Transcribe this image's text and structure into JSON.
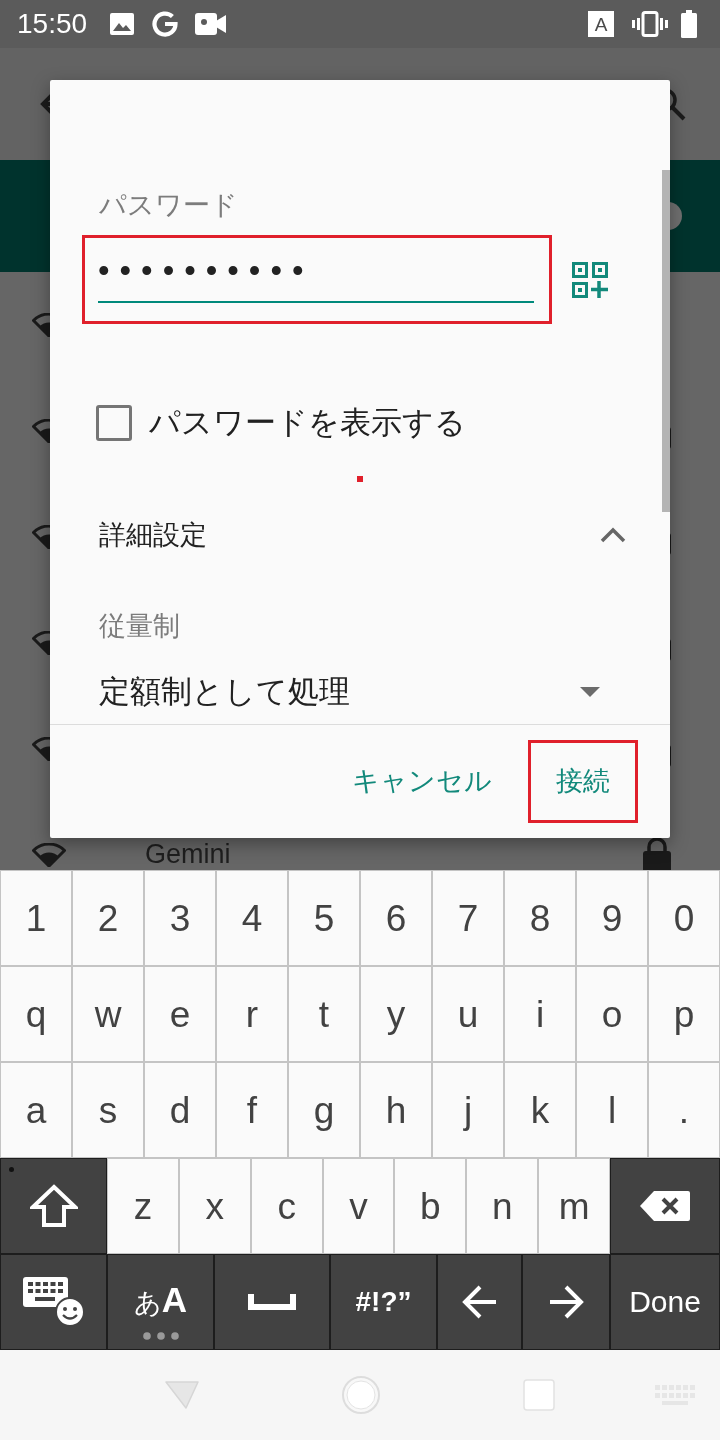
{
  "status_bar": {
    "time": "15:50",
    "input_mode": "A"
  },
  "wifi_switch": {
    "on": true
  },
  "networks": [
    {
      "secured": false
    },
    {
      "secured": true
    },
    {
      "secured": true
    },
    {
      "secured": true
    },
    {
      "secured": true
    },
    {
      "name": "Gemini",
      "secured": true
    }
  ],
  "dialog": {
    "password": {
      "label": "パスワード",
      "value": "••••••••••",
      "highlighted": true
    },
    "show_password": {
      "label": "パスワードを表示する",
      "checked": false
    },
    "advanced": {
      "label": "詳細設定",
      "expanded": true
    },
    "metered": {
      "label": "従量制",
      "value": "定額制として処理"
    },
    "buttons": [
      {
        "label": "キャンセル",
        "highlighted": false
      },
      {
        "label": "接続",
        "highlighted": true
      }
    ]
  },
  "keyboard": {
    "rows": [
      {
        "keys": [
          {
            "kind": "char",
            "label": "1"
          },
          {
            "kind": "char",
            "label": "2"
          },
          {
            "kind": "char",
            "label": "3"
          },
          {
            "kind": "char",
            "label": "4"
          },
          {
            "kind": "char",
            "label": "5"
          },
          {
            "kind": "char",
            "label": "6"
          },
          {
            "kind": "char",
            "label": "7"
          },
          {
            "kind": "char",
            "label": "8"
          },
          {
            "kind": "char",
            "label": "9"
          },
          {
            "kind": "char",
            "label": "0"
          }
        ]
      },
      {
        "keys": [
          {
            "kind": "char",
            "label": "q"
          },
          {
            "kind": "char",
            "label": "w"
          },
          {
            "kind": "char",
            "label": "e"
          },
          {
            "kind": "char",
            "label": "r"
          },
          {
            "kind": "char",
            "label": "t"
          },
          {
            "kind": "char",
            "label": "y"
          },
          {
            "kind": "char",
            "label": "u"
          },
          {
            "kind": "char",
            "label": "i"
          },
          {
            "kind": "char",
            "label": "o"
          },
          {
            "kind": "char",
            "label": "p"
          }
        ]
      },
      {
        "keys": [
          {
            "kind": "char",
            "label": "a"
          },
          {
            "kind": "char",
            "label": "s"
          },
          {
            "kind": "char",
            "label": "d"
          },
          {
            "kind": "char",
            "label": "f"
          },
          {
            "kind": "char",
            "label": "g"
          },
          {
            "kind": "char",
            "label": "h"
          },
          {
            "kind": "char",
            "label": "j"
          },
          {
            "kind": "char",
            "label": "k"
          },
          {
            "kind": "char",
            "label": "l"
          },
          {
            "kind": "char",
            "label": "."
          }
        ]
      },
      {
        "keys": [
          {
            "kind": "shift"
          },
          {
            "kind": "char",
            "label": "z"
          },
          {
            "kind": "char",
            "label": "x"
          },
          {
            "kind": "char",
            "label": "c"
          },
          {
            "kind": "char",
            "label": "v"
          },
          {
            "kind": "char",
            "label": "b"
          },
          {
            "kind": "char",
            "label": "n"
          },
          {
            "kind": "char",
            "label": "m"
          },
          {
            "kind": "backspace"
          }
        ]
      },
      {
        "keys": [
          {
            "kind": "emoji_keyboard"
          },
          {
            "kind": "mode",
            "label": "あ**A**"
          },
          {
            "kind": "space"
          },
          {
            "kind": "symbols",
            "label": "#!?”"
          },
          {
            "kind": "left"
          },
          {
            "kind": "right"
          },
          {
            "kind": "done",
            "label": "Done"
          }
        ]
      }
    ]
  }
}
